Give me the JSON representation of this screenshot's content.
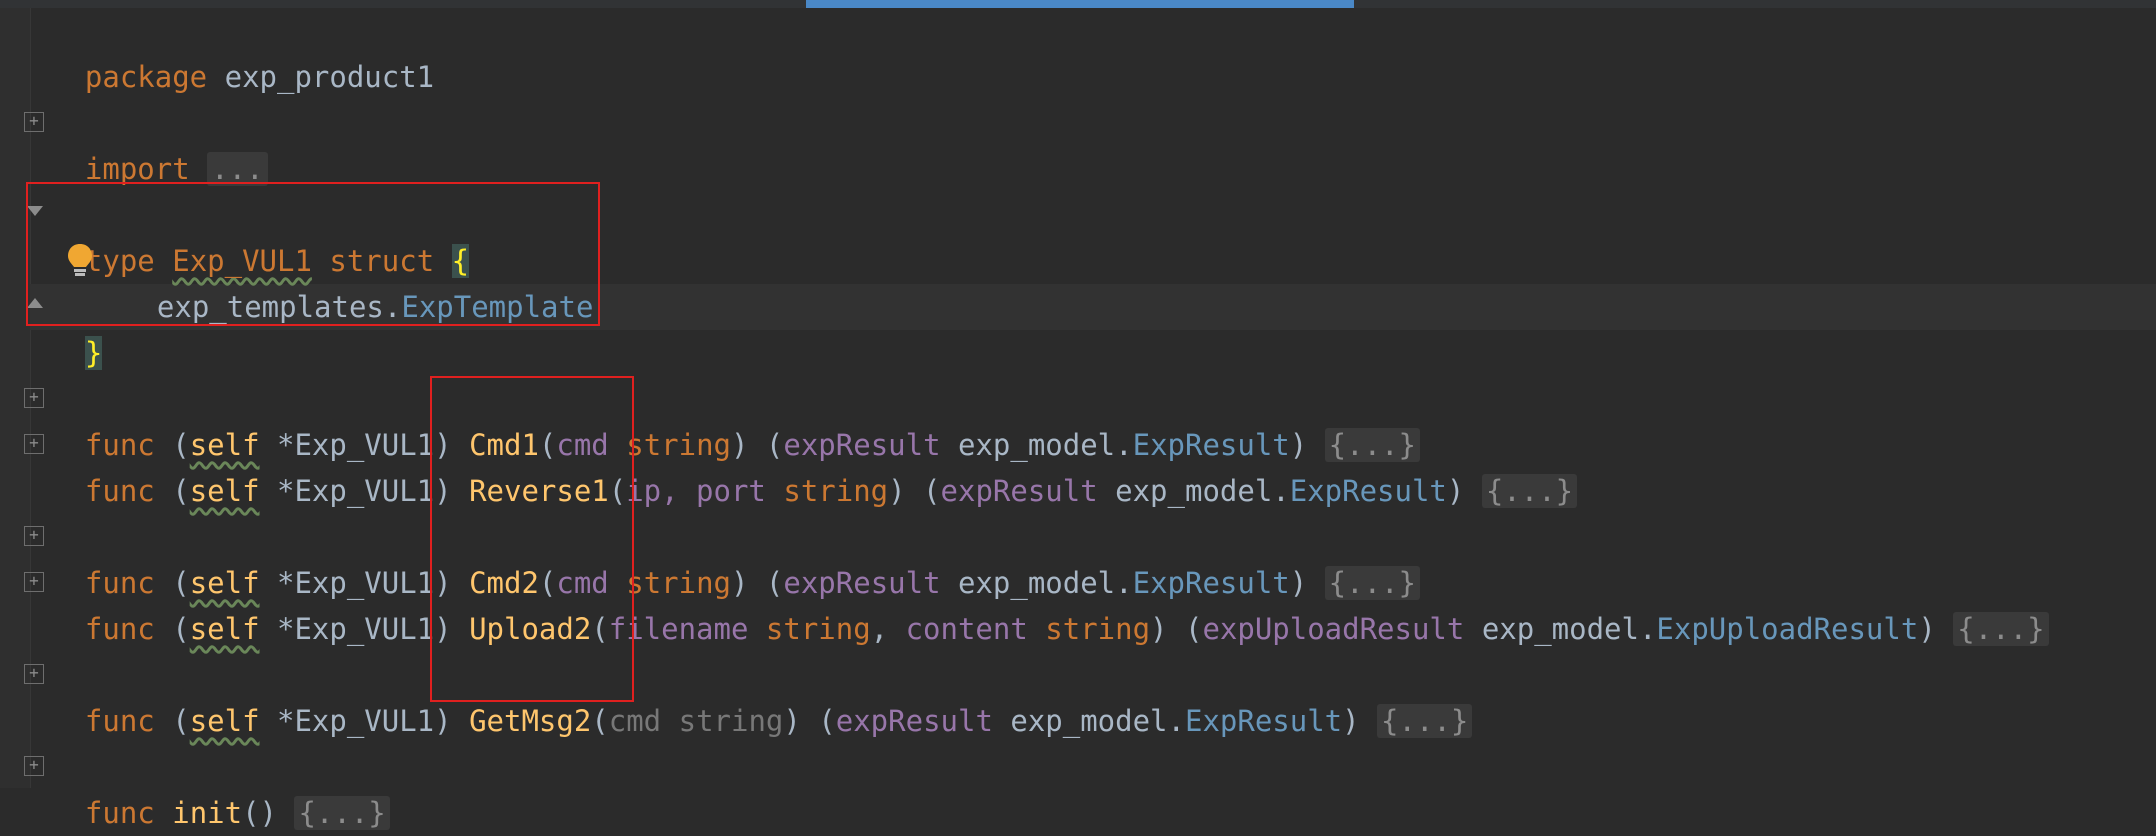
{
  "code": {
    "package_kw": "package",
    "package_name": "exp_product1",
    "import_kw": "import",
    "folded_ellipsis": "...",
    "folded_block": "{...}",
    "type_kw": "type",
    "struct_name": "Exp_VUL1",
    "struct_kw": "struct",
    "open_brace": "{",
    "close_brace": "}",
    "field_pkg": "exp_templates",
    "field_type": "ExpTemplate",
    "func_kw": "func",
    "self_name": "self",
    "receiver_type": "*Exp_VUL1",
    "methods": [
      {
        "name": "Cmd1",
        "params": [
          {
            "n": "cmd",
            "t": "string"
          }
        ],
        "ret_name": "expResult",
        "ret_pkg": "exp_model",
        "ret_type": "ExpResult"
      },
      {
        "name": "Reverse1",
        "params": [
          {
            "n": "ip, port",
            "t": "string"
          }
        ],
        "ret_name": "expResult",
        "ret_pkg": "exp_model",
        "ret_type": "ExpResult"
      },
      {
        "name": "Cmd2",
        "params": [
          {
            "n": "cmd",
            "t": "string"
          }
        ],
        "ret_name": "expResult",
        "ret_pkg": "exp_model",
        "ret_type": "ExpResult"
      },
      {
        "name": "Upload2",
        "params": [
          {
            "n": "filename",
            "t": "string"
          },
          {
            "n": "content",
            "t": "string"
          }
        ],
        "ret_name": "expUploadResult",
        "ret_pkg": "exp_model",
        "ret_type": "ExpUploadResult"
      },
      {
        "name": "GetMsg2",
        "params": [
          {
            "n": "cmd",
            "t": "string"
          }
        ],
        "ret_name": "expResult",
        "ret_pkg": "exp_model",
        "ret_type": "ExpResult"
      }
    ],
    "init_name": "init"
  },
  "colors": {
    "keyword": "#cc7832",
    "function": "#ffc66d",
    "param": "#9876aa",
    "type_ref": "#6897bb",
    "highlight_box": "#e0201f",
    "accent_bar": "#4a88c7"
  },
  "icons": {
    "bulb": "lightbulb-icon",
    "fold": "fold-toggle-icon"
  }
}
